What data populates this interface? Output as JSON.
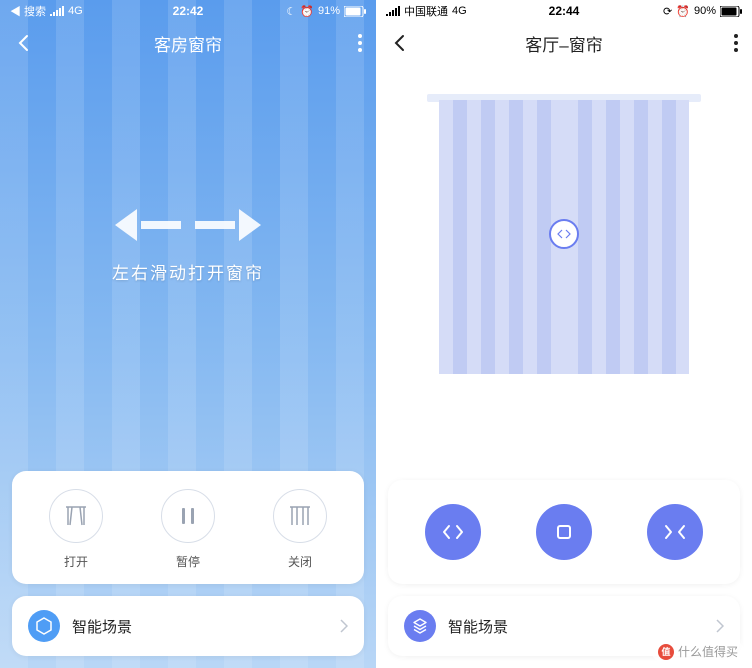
{
  "left": {
    "status": {
      "carrier_prefix": "◀ 搜索",
      "signal_label": "4G",
      "time": "22:42",
      "alarm": true,
      "battery_pct": "91%"
    },
    "nav": {
      "title": "客房窗帘"
    },
    "curtain_hint": "左右滑动打开窗帘",
    "controls": {
      "open": "打开",
      "pause": "暂停",
      "close": "关闭"
    },
    "scene": {
      "label": "智能场景"
    }
  },
  "right": {
    "status": {
      "carrier": "中国联通",
      "signal_label": "4G",
      "time": "22:44",
      "alarm": true,
      "battery_pct": "90%"
    },
    "nav": {
      "title": "客厅–窗帘"
    },
    "scene": {
      "label": "智能场景"
    }
  },
  "watermark": "什么值得买"
}
